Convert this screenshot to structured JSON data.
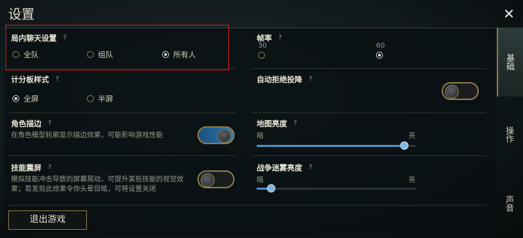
{
  "window": {
    "title": "设置"
  },
  "chat": {
    "label": "局内聊天设置",
    "options": [
      {
        "label": "全队",
        "selected": false
      },
      {
        "label": "组队",
        "selected": false
      },
      {
        "label": "所有人",
        "selected": true
      }
    ]
  },
  "fps": {
    "label": "帧率",
    "options": [
      {
        "label": "30",
        "selected": false
      },
      {
        "label": "60",
        "selected": true
      }
    ]
  },
  "scoreboard": {
    "label": "计分板样式",
    "options": [
      {
        "label": "全屏",
        "selected": true
      },
      {
        "label": "半屏",
        "selected": false
      }
    ]
  },
  "surrender": {
    "label": "自动拒绝投降",
    "on": false
  },
  "outline": {
    "label": "角色描边",
    "desc": "在角色模型轮廓显示描边效果，可能影响游戏性能",
    "on": true
  },
  "map_brightness": {
    "label": "地图亮度",
    "min_label": "暗",
    "max_label": "亮",
    "value": 0.93
  },
  "shake": {
    "label": "技能震屏",
    "desc_line1": "模拟技能冲击导致的屏幕晃动，可提升某些技能的视觉效",
    "desc_line2": "果；若发现此效果令你头晕目眩，可将设置关闭",
    "on": false
  },
  "fog_brightness": {
    "label": "战争迷雾亮度",
    "min_label": "暗",
    "max_label": "亮",
    "value": 0.09
  },
  "exit_button": "退出游戏",
  "tabs": [
    {
      "label": "基础",
      "active": true
    },
    {
      "label": "操作",
      "active": false
    },
    {
      "label": "声音",
      "active": false
    }
  ],
  "help_symbol": "?",
  "close_symbol": "✕",
  "colors": {
    "accent": "#4d8fc2",
    "gold": "#8d7a4a",
    "highlight": "#e02020"
  }
}
